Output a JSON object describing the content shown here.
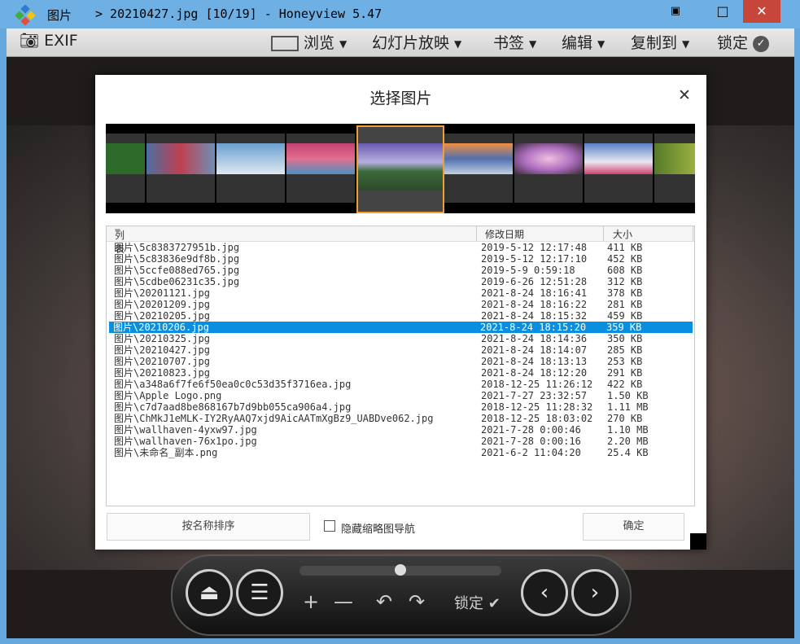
{
  "window": {
    "title_folder": "图片",
    "title_file": "> 20210427.jpg [10/19] - Honeyview 5.47",
    "btn_min": "▣",
    "btn_max": "□",
    "btn_close": "✕"
  },
  "menubar": {
    "exif": "EXIF",
    "browse": "浏览",
    "slideshow": "幻灯片放映",
    "bookmark": "书签",
    "edit": "编辑",
    "copy_to": "复制到",
    "lock": "锁定"
  },
  "dialog": {
    "title": "选择图片",
    "close": "✕",
    "columns": {
      "name": "列表",
      "date": "修改日期",
      "size": "大小"
    },
    "files": [
      {
        "name": "图片\\5c8383727951b.jpg",
        "date": "2019-5-12 12:17:48",
        "size": "411 KB"
      },
      {
        "name": "图片\\5c83836e9df8b.jpg",
        "date": "2019-5-12 12:17:10",
        "size": "452 KB"
      },
      {
        "name": "图片\\5ccfe088ed765.jpg",
        "date": "2019-5-9 0:59:18",
        "size": "608 KB"
      },
      {
        "name": "图片\\5cdbe06231c35.jpg",
        "date": "2019-6-26 12:51:28",
        "size": "312 KB"
      },
      {
        "name": "图片\\20201121.jpg",
        "date": "2021-8-24 18:16:41",
        "size": "378 KB"
      },
      {
        "name": "图片\\20201209.jpg",
        "date": "2021-8-24 18:16:22",
        "size": "281 KB"
      },
      {
        "name": "图片\\20210205.jpg",
        "date": "2021-8-24 18:15:32",
        "size": "459 KB"
      },
      {
        "name": "图片\\20210206.jpg",
        "date": "2021-8-24 18:15:20",
        "size": "359 KB"
      },
      {
        "name": "图片\\20210325.jpg",
        "date": "2021-8-24 18:14:36",
        "size": "350 KB"
      },
      {
        "name": "图片\\20210427.jpg",
        "date": "2021-8-24 18:14:07",
        "size": "285 KB"
      },
      {
        "name": "图片\\20210707.jpg",
        "date": "2021-8-24 18:13:13",
        "size": "253 KB"
      },
      {
        "name": "图片\\20210823.jpg",
        "date": "2021-8-24 18:12:20",
        "size": "291 KB"
      },
      {
        "name": "图片\\a348a6f7fe6f50ea0c0c53d35f3716ea.jpg",
        "date": "2018-12-25 11:26:12",
        "size": "422 KB"
      },
      {
        "name": "图片\\Apple Logo.png",
        "date": "2021-7-27 23:32:57",
        "size": "1.50 KB"
      },
      {
        "name": "图片\\c7d7aad8be868167b7d9bb055ca906a4.jpg",
        "date": "2018-12-25 11:28:32",
        "size": "1.11 MB"
      },
      {
        "name": "图片\\ChMkJ1eMLK-IY2RyAAQ7xjd9AicAATmXgBz9_UABDve062.jpg",
        "date": "2018-12-25 18:03:02",
        "size": "270 KB"
      },
      {
        "name": "图片\\wallhaven-4yxw97.jpg",
        "date": "2021-7-28 0:00:46",
        "size": "1.10 MB"
      },
      {
        "name": "图片\\wallhaven-76x1po.jpg",
        "date": "2021-7-28 0:00:16",
        "size": "2.20 MB"
      },
      {
        "name": "图片\\未命名_副本.png",
        "date": "2021-6-2 11:04:20",
        "size": "25.4 KB"
      }
    ],
    "selected_index": 7,
    "sort_button": "按名称排序",
    "hide_thumbs_label": "隐藏缩略图导航",
    "ok_button": "确定",
    "thumb_colors": [
      "#2d6a2a",
      "#6f8fb8",
      "#8fb4d4",
      "#c0505a",
      "#5a7fb0",
      "#d88a55",
      "#b070c0",
      "#5a80c8",
      "#557a2a"
    ]
  },
  "controls": {
    "eject": "⏏",
    "menu": "☰",
    "zoom_in": "+",
    "zoom_out": "—",
    "rotate_left": "↶",
    "rotate_right": "↷",
    "lock": "锁定",
    "prev": "‹",
    "next": "›",
    "progress": 0.5
  }
}
